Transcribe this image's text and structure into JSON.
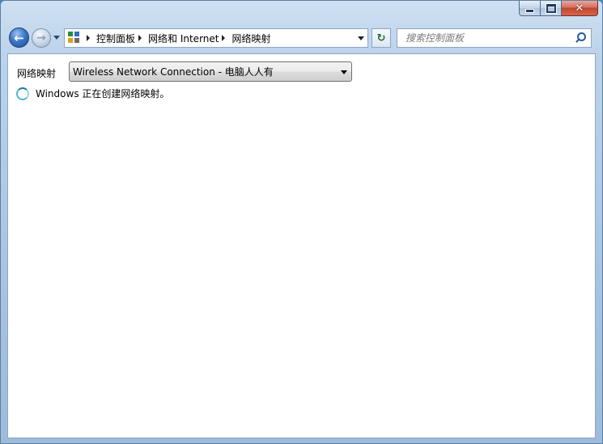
{
  "window": {
    "minimize_glyph": "minimize-icon",
    "maximize_glyph": "maximize-icon",
    "close_glyph": "✕"
  },
  "nav": {
    "back_glyph": "←",
    "forward_glyph": "→"
  },
  "breadcrumb": {
    "items": [
      "控制面板",
      "网络和 Internet",
      "网络映射"
    ]
  },
  "search": {
    "placeholder": "搜索控制面板"
  },
  "main": {
    "map_label": "网络映射",
    "map_select_value": "Wireless Network Connection - 电脑人人有",
    "status_text": "Windows 正在创建网络映射。"
  },
  "colors": {
    "accent": "#3c78c7",
    "close_red": "#c4442c"
  }
}
